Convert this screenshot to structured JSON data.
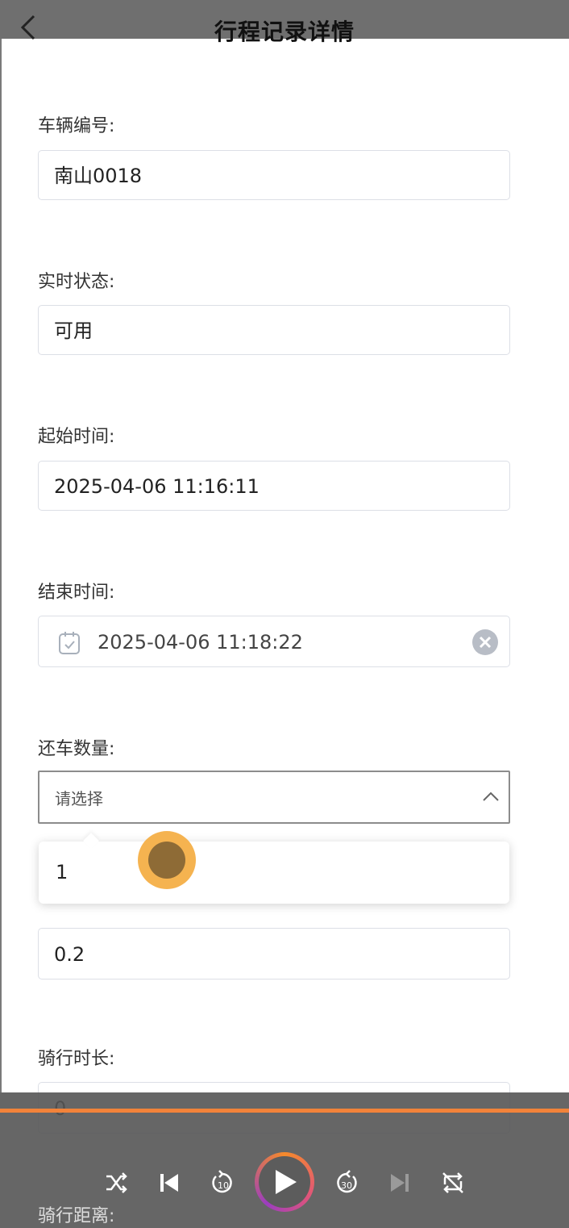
{
  "header": {
    "title": "行程记录详情"
  },
  "form": {
    "vehicle_label": "车辆编号:",
    "vehicle_value": "南山0018",
    "status_label": "实时状态:",
    "status_value": "可用",
    "start_label": "起始时间:",
    "start_value": "2025-04-06 11:16:11",
    "end_label": "结束时间:",
    "end_value": "2025-04-06 11:18:22",
    "return_label": "还车数量:",
    "return_placeholder": "请选择",
    "return_options": [
      "1"
    ],
    "price_value": "0.2",
    "duration_label": "骑行时长:",
    "duration_value": "0",
    "distance_label": "骑行距离:"
  },
  "player": {
    "progress_percent": 100,
    "controls": [
      "shuffle-icon",
      "skip-previous-icon",
      "rewind-10-icon",
      "play-icon",
      "forward-30-icon",
      "skip-next-icon",
      "repeat-icon"
    ],
    "rewind_seconds": "10",
    "forward_seconds": "30"
  },
  "colors": {
    "accent": "#f2833a",
    "cursor": "#f5b350"
  }
}
